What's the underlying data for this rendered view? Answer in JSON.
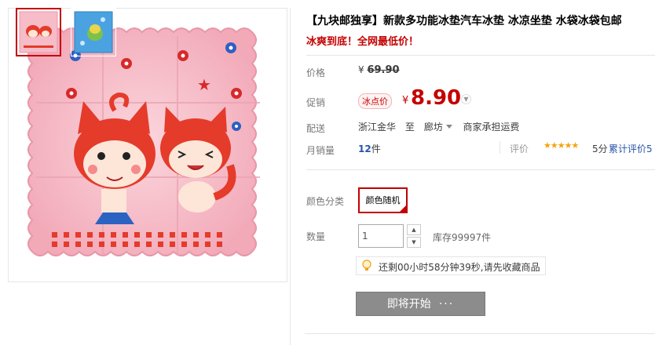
{
  "product": {
    "title": "【九块邮独享】新款多功能冰垫汽车冰垫 冰凉坐垫 水袋冰袋包邮",
    "subtitle": "冰爽到底！全网最低价！"
  },
  "price": {
    "label": "价格",
    "currency": "¥",
    "original": "69.90",
    "promo_label": "促销",
    "promo_badge": "冰点价",
    "promo_currency": "¥",
    "promo_value": "8.90"
  },
  "shipping": {
    "label": "配送",
    "from": "浙江金华",
    "to_word": "至",
    "destination": "廊坊",
    "fee_text": "商家承担运费"
  },
  "sales": {
    "label": "月销量",
    "count": "12",
    "unit": "件",
    "review_label": "评价",
    "stars": "★★★★★",
    "score": "5分",
    "review_count_text": "累计评价5"
  },
  "sku": {
    "color_label": "颜色分类",
    "color_option": "颜色随机"
  },
  "quantity": {
    "label": "数量",
    "value": "1",
    "stock_text": "库存99997件"
  },
  "notice": {
    "text": "还剩00小时58分钟39秒,请先收藏商品"
  },
  "action": {
    "button_label": "即将开始",
    "button_dots": "···"
  },
  "colors": {
    "accent": "#c40000",
    "link": "#2953a6",
    "star": "#f4a30f",
    "button_gray": "#8c8c8c"
  },
  "icons": {
    "bulb": "lightbulb-icon",
    "chevron": "chevron-down-icon"
  }
}
